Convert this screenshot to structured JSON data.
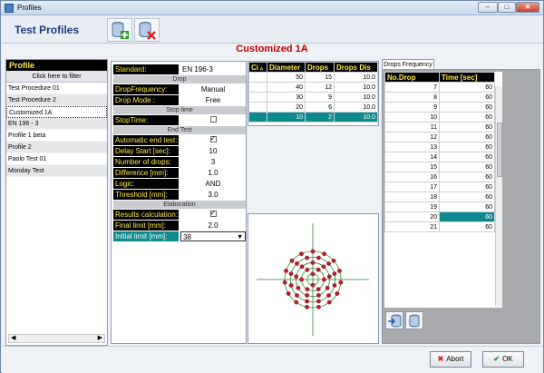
{
  "window": {
    "title": "Profiles",
    "min": "–",
    "max": "□",
    "close": "✕"
  },
  "header": {
    "title": "Test Profiles"
  },
  "subtitle": "Customized 1A",
  "profiles": {
    "title": "Profile",
    "filter": "Click here to filter",
    "items": [
      "Test Procedure 01",
      "Test Procedure 2",
      "Customized 1A",
      "EN 196 - 3",
      "Profile 1 beta",
      "Profile 2",
      "Paolo Test 01",
      "Monday Test"
    ]
  },
  "form": {
    "standard_label": "Standard:",
    "standard_value": "EN 196-3",
    "sec_drop": "Drop",
    "dropfreq_label": "DropFrequency:",
    "dropfreq_value": "Manual",
    "dropmode_label": "Drop Mode :",
    "dropmode_value": "Free",
    "sec_stop": "Stop time",
    "stoptime_label": "StopTime:",
    "sec_end": "End Test",
    "auto_label": "Automatic end test:",
    "delay_label": "Delay Start [sec]:",
    "delay_value": "10",
    "ndrops_label": "Number of drops:",
    "ndrops_value": "3",
    "diff_label": "Difference [mm]:",
    "diff_value": "1.0",
    "logic_label": "Logic:",
    "logic_value": "AND",
    "thr_label": "Threshold [mm]:",
    "thr_value": "3.0",
    "sec_elab": "Elaboration",
    "results_label": "Results calculation:",
    "final_label": "Final limit [mm]:",
    "final_value": "2.0",
    "initial_label": "Initial limit [mm]:",
    "initial_value": "38"
  },
  "grid": {
    "headers": [
      "Ci",
      "Diameter",
      "Drops",
      "Drops Dis"
    ],
    "rows": [
      [
        "50",
        "15",
        "10.0"
      ],
      [
        "40",
        "12",
        "10.0"
      ],
      [
        "30",
        "9",
        "10.0"
      ],
      [
        "20",
        "6",
        "10.0"
      ],
      [
        "10",
        "2",
        "10.0"
      ]
    ]
  },
  "tabs": {
    "active": "Drops Frequency"
  },
  "drops": {
    "headers": [
      "No.Drop",
      "Time [sec]"
    ],
    "rows": [
      [
        "7",
        "60"
      ],
      [
        "8",
        "60"
      ],
      [
        "9",
        "60"
      ],
      [
        "10",
        "60"
      ],
      [
        "11",
        "60"
      ],
      [
        "12",
        "60"
      ],
      [
        "13",
        "60"
      ],
      [
        "14",
        "60"
      ],
      [
        "15",
        "60"
      ],
      [
        "16",
        "60"
      ],
      [
        "17",
        "60"
      ],
      [
        "18",
        "60"
      ],
      [
        "19",
        "60"
      ],
      [
        "20",
        "60"
      ],
      [
        "21",
        "60"
      ]
    ]
  },
  "buttons": {
    "abort": "Abort",
    "ok": "OK"
  },
  "colors": {
    "accent": "#0d8a8d",
    "label_bg": "#000000",
    "label_fg": "#ffe84a",
    "title": "#c00000"
  },
  "icons": {
    "add": "add-profile-icon",
    "delete": "delete-profile-icon"
  }
}
